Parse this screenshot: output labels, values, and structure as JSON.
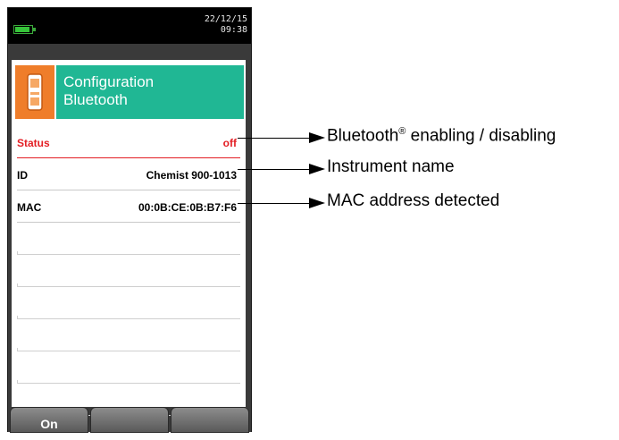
{
  "statusbar": {
    "date": "22/12/15",
    "time": "09:38",
    "battery_level": 0.9,
    "battery_color": "#36c43a"
  },
  "header": {
    "icon": "bluetooth-device-icon",
    "title_line1": "Configuration",
    "title_line2": "Bluetooth",
    "icon_bg": "#ef7d2a",
    "title_bg": "#20b794"
  },
  "rows": [
    {
      "label": "Status",
      "value": "off"
    },
    {
      "label": "ID",
      "value": "Chemist 900-1013"
    },
    {
      "label": "MAC",
      "value": "00:0B:CE:0B:B7:F6"
    }
  ],
  "softkeys": [
    "On",
    "",
    ""
  ],
  "callouts": {
    "status_text": "Bluetooth",
    "status_mark": "®",
    "status_text_suffix": " enabling / disabling",
    "id_text": "Instrument name",
    "mac_text": "MAC address detected"
  },
  "colors": {
    "status_red": "#e31e24"
  }
}
